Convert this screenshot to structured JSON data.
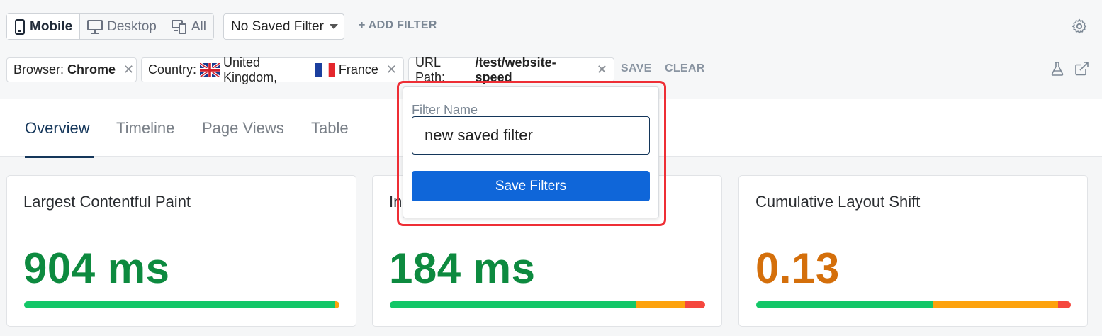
{
  "device_toggle": {
    "mobile_label": "Mobile",
    "desktop_label": "Desktop",
    "all_label": "All",
    "selected": "Mobile"
  },
  "saved_filter": {
    "value": "No Saved Filter"
  },
  "add_filter_label": "+ ADD FILTER",
  "filters": [
    {
      "key": "Browser:",
      "value": "Chrome"
    },
    {
      "key": "Country:",
      "values": [
        "United Kingdom,",
        "France"
      ]
    },
    {
      "key": "URL Path:",
      "value": "/test/website-speed"
    }
  ],
  "filter_actions": {
    "save_label": "SAVE",
    "clear_label": "CLEAR"
  },
  "tabs": [
    {
      "label": "Overview",
      "active": true
    },
    {
      "label": "Timeline"
    },
    {
      "label": "Page Views"
    },
    {
      "label": "Table"
    }
  ],
  "cards": [
    {
      "title": "Largest Contentful Paint",
      "value": "904 ms",
      "value_color": "#0d8a3f",
      "distribution": {
        "good": 0.986,
        "needs_improvement": 0.014,
        "poor": 0
      }
    },
    {
      "title": "In",
      "value": "184 ms",
      "value_color": "#0d8a3f",
      "distribution": {
        "good": 0.78,
        "needs_improvement": 0.155,
        "poor": 0.065
      }
    },
    {
      "title": "Cumulative Layout Shift",
      "value": "0.13",
      "value_color": "#d46f0b",
      "distribution": {
        "good": 0.56,
        "needs_improvement": 0.4,
        "poor": 0.04
      }
    }
  ],
  "popup": {
    "label": "Filter Name",
    "input_value": "new saved filter",
    "button_label": "Save Filters"
  },
  "colors": {
    "accent_blue": "#0f66d9",
    "navy": "#14365a",
    "good": "#13c768",
    "needs_improvement": "#fda20d",
    "poor": "#f5473e",
    "highlight": "#ee2e35"
  }
}
